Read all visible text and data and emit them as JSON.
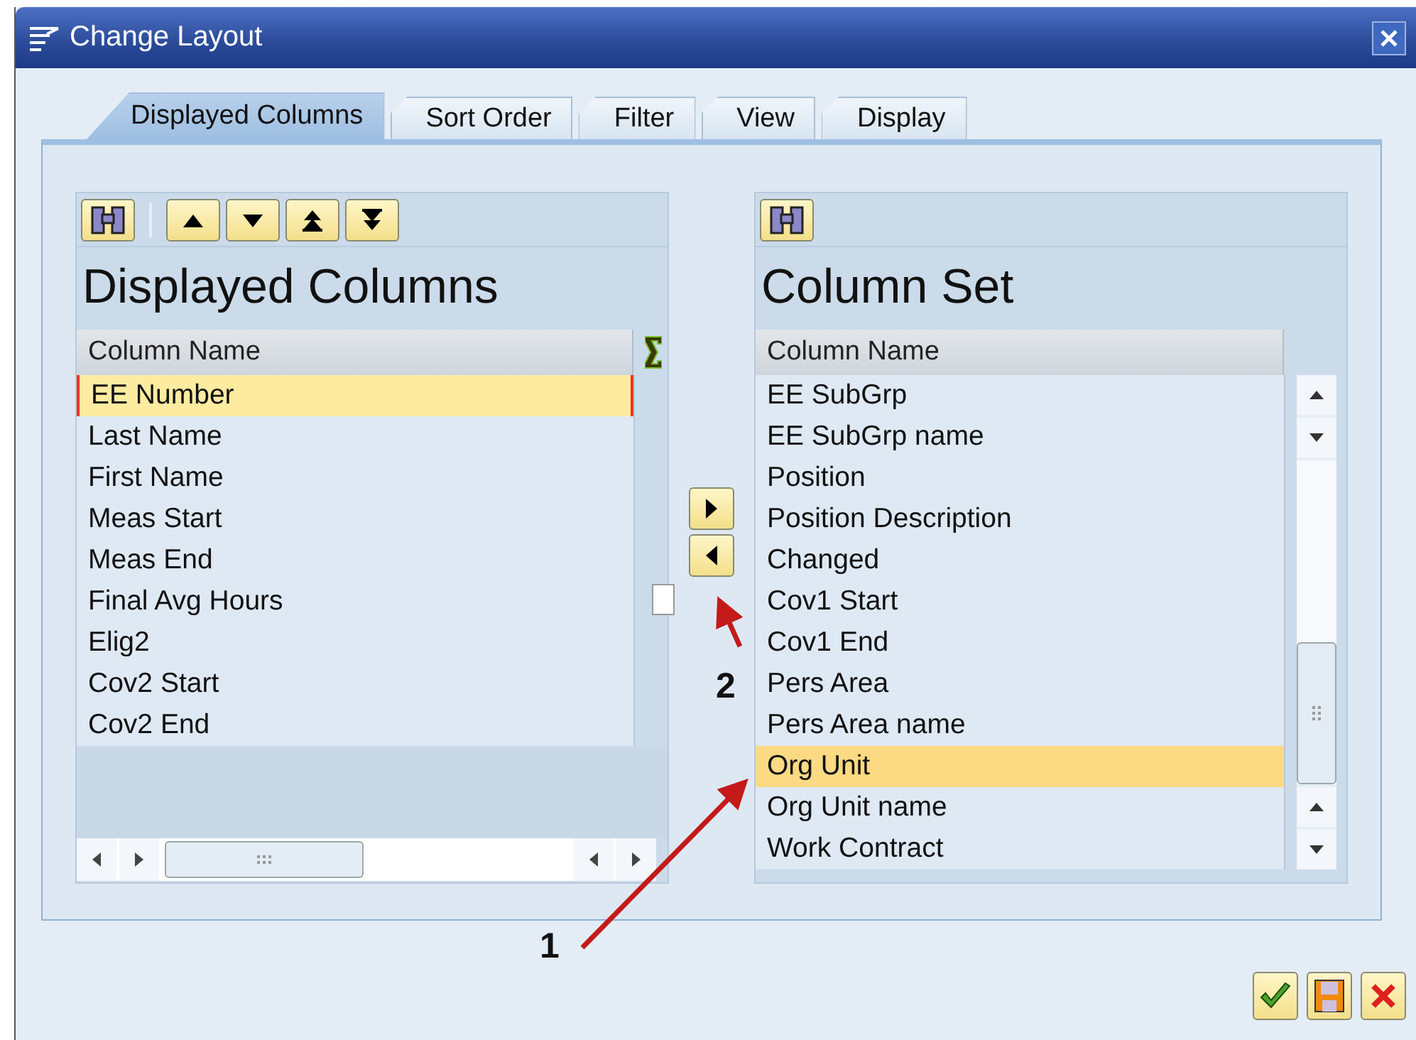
{
  "window": {
    "title": "Change Layout"
  },
  "tabs": [
    {
      "label": "Displayed Columns",
      "selected": true
    },
    {
      "label": "Sort Order",
      "selected": false
    },
    {
      "label": "Filter",
      "selected": false
    },
    {
      "label": "View",
      "selected": false
    },
    {
      "label": "Display",
      "selected": false
    }
  ],
  "displayed_columns": {
    "title": "Displayed Columns",
    "column_header": "Column Name",
    "rows": [
      {
        "label": "EE Number",
        "selected": true
      },
      {
        "label": "Last Name",
        "selected": false
      },
      {
        "label": "First Name",
        "selected": false
      },
      {
        "label": "Meas Start",
        "selected": false
      },
      {
        "label": "Meas End",
        "selected": false
      },
      {
        "label": "Final Avg Hours",
        "selected": false,
        "sum_checked": false
      },
      {
        "label": "Elig2",
        "selected": false
      },
      {
        "label": "Cov2 Start",
        "selected": false
      },
      {
        "label": "Cov2 End",
        "selected": false
      }
    ]
  },
  "column_set": {
    "title": "Column Set",
    "column_header": "Column Name",
    "rows": [
      {
        "label": "EE SubGrp",
        "selected": false
      },
      {
        "label": "EE SubGrp name",
        "selected": false
      },
      {
        "label": "Position",
        "selected": false
      },
      {
        "label": "Position Description",
        "selected": false
      },
      {
        "label": "Changed",
        "selected": false
      },
      {
        "label": "Cov1 Start",
        "selected": false
      },
      {
        "label": "Cov1 End",
        "selected": false
      },
      {
        "label": "Pers Area",
        "selected": false
      },
      {
        "label": "Pers Area name",
        "selected": false
      },
      {
        "label": "Org Unit",
        "selected": true
      },
      {
        "label": "Org Unit name",
        "selected": false
      },
      {
        "label": "Work Contract",
        "selected": false
      }
    ]
  },
  "annotations": [
    {
      "label": "1"
    },
    {
      "label": "2"
    }
  ]
}
